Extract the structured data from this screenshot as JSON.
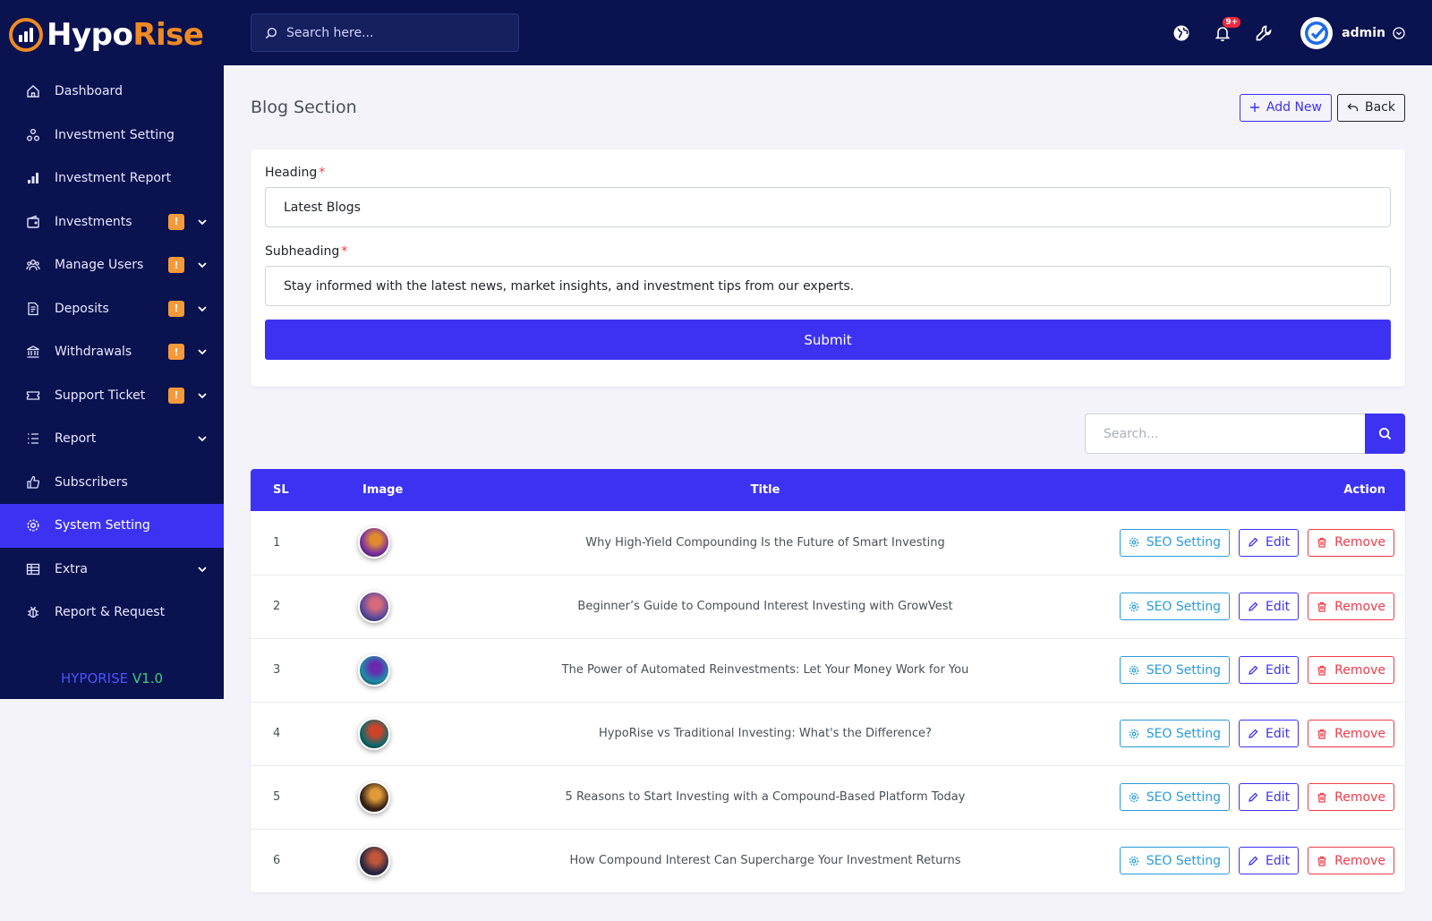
{
  "brand": {
    "name_part1": "Hypo",
    "name_part2": "Rise"
  },
  "sidebar": {
    "items": [
      {
        "label": "Dashboard",
        "icon": "home-icon"
      },
      {
        "label": "Investment Setting",
        "icon": "nodes-icon"
      },
      {
        "label": "Investment Report",
        "icon": "bar-chart-icon"
      },
      {
        "label": "Investments",
        "icon": "wallet-icon",
        "badge": "!"
      },
      {
        "label": "Manage Users",
        "icon": "users-icon",
        "badge": "!"
      },
      {
        "label": "Deposits",
        "icon": "receipt-icon",
        "badge": "!"
      },
      {
        "label": "Withdrawals",
        "icon": "bank-icon",
        "badge": "!"
      },
      {
        "label": "Support Ticket",
        "icon": "ticket-icon",
        "badge": "!"
      },
      {
        "label": "Report",
        "icon": "list-icon"
      },
      {
        "label": "Subscribers",
        "icon": "thumbs-up-icon"
      },
      {
        "label": "System Setting",
        "icon": "settings-icon"
      },
      {
        "label": "Extra",
        "icon": "table-icon"
      },
      {
        "label": "Report & Request",
        "icon": "bug-icon"
      }
    ],
    "version_name": "HYPORISE",
    "version_number": "V1.0"
  },
  "topbar": {
    "search_placeholder": "Search here...",
    "notification_count": "9+",
    "user_name": "admin"
  },
  "page": {
    "title": "Blog Section",
    "add_new_label": "Add New",
    "back_label": "Back"
  },
  "form": {
    "heading_label": "Heading",
    "heading_value": "Latest Blogs",
    "subheading_label": "Subheading",
    "subheading_value": "Stay informed with the latest news, market insights, and investment tips from our experts.",
    "required_mark": "*",
    "submit_label": "Submit"
  },
  "table": {
    "search_placeholder": "Search...",
    "columns": {
      "sl": "SL",
      "image": "Image",
      "title": "Title",
      "action": "Action"
    },
    "actions": {
      "seo": "SEO Setting",
      "edit": "Edit",
      "remove": "Remove"
    },
    "rows": [
      {
        "sl": "1",
        "title": "Why High-Yield Compounding Is the Future of Smart Investing",
        "thumb_colors": [
          "#7a2fa3",
          "#e08a2e"
        ]
      },
      {
        "sl": "2",
        "title": "Beginner’s Guide to Compound Interest Investing with GrowVest",
        "thumb_colors": [
          "#5a4a9e",
          "#d46a7a"
        ]
      },
      {
        "sl": "3",
        "title": "The Power of Automated Reinvestments: Let Your Money Work for You",
        "thumb_colors": [
          "#1d8fa8",
          "#6a2ab0"
        ]
      },
      {
        "sl": "4",
        "title": "HypoRise vs Traditional Investing: What's the Difference?",
        "thumb_colors": [
          "#0f6a6a",
          "#d0432b"
        ]
      },
      {
        "sl": "5",
        "title": "5 Reasons to Start Investing with a Compound-Based Platform Today",
        "thumb_colors": [
          "#3a2418",
          "#e09a3a"
        ]
      },
      {
        "sl": "6",
        "title": "How Compound Interest Can Supercharge Your Investment Returns",
        "thumb_colors": [
          "#2a2a44",
          "#c0563a"
        ]
      }
    ]
  },
  "colors": {
    "sidebar_bg": "#0a1250",
    "primary": "#3d32f2",
    "accent": "#f08a24",
    "info": "#299cdb",
    "danger": "#f03b49",
    "badge": "#f59a3b"
  }
}
